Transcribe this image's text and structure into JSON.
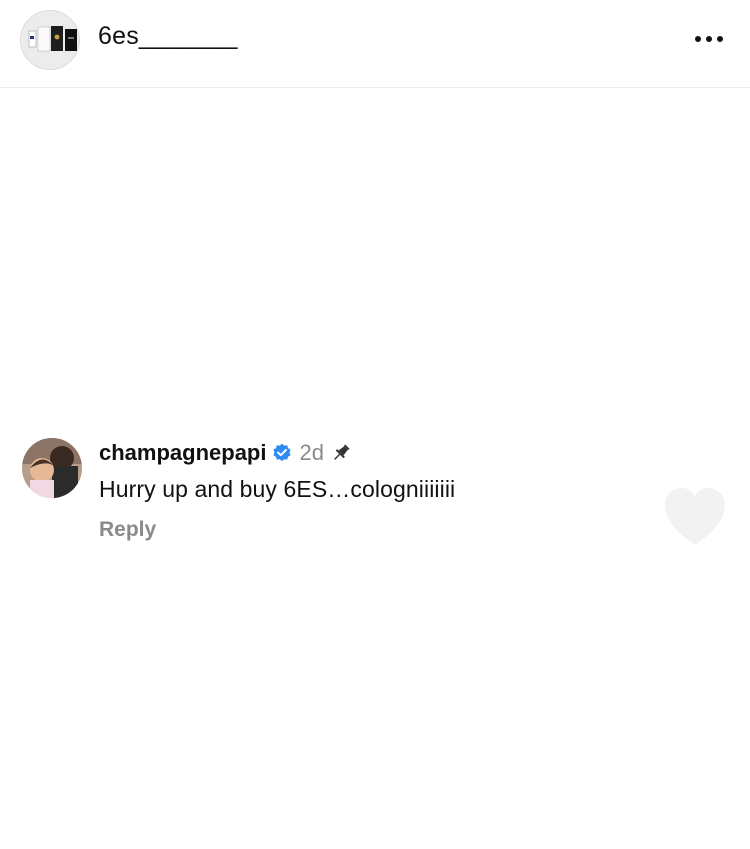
{
  "post": {
    "username": "6es_______",
    "avatar_icon": "product-photo-avatar",
    "more_icon": "more-horizontal-icon"
  },
  "comment": {
    "username": "champagnepapi",
    "verified_icon": "verified-badge-icon",
    "verified_color": "#2d8cf0",
    "time": "2d",
    "pin_icon": "pin-icon",
    "text": "Hurry up and buy 6ES…cologniiiiiii",
    "reply_label": "Reply"
  }
}
